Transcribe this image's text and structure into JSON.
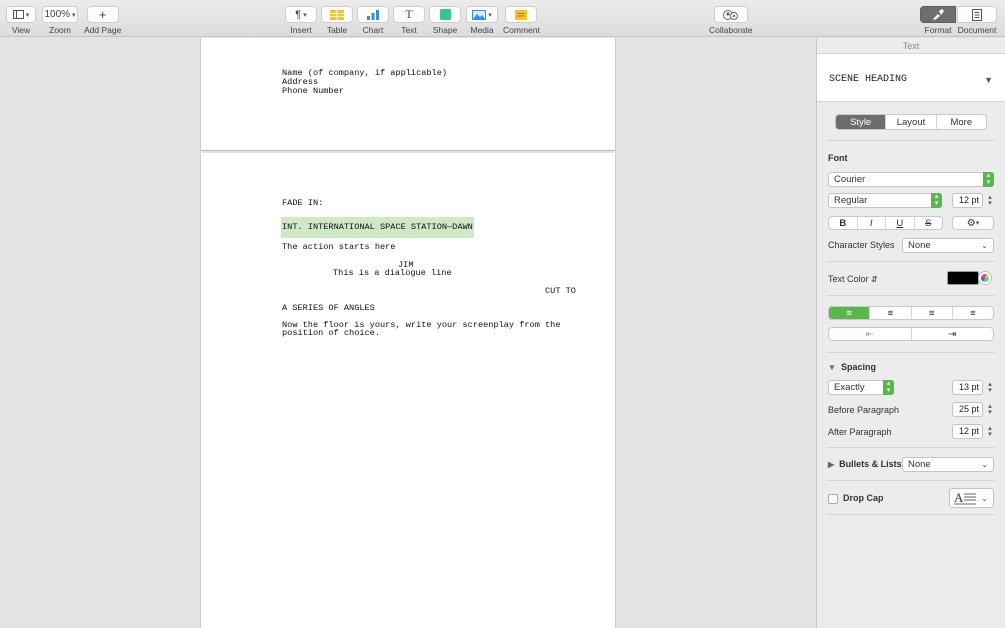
{
  "toolbar": {
    "view": {
      "label": "View"
    },
    "zoom": {
      "value": "100%",
      "label": "Zoom"
    },
    "add_page": {
      "label": "Add Page"
    },
    "insert": {
      "label": "Insert"
    },
    "table": {
      "label": "Table"
    },
    "chart": {
      "label": "Chart"
    },
    "text": {
      "label": "Text"
    },
    "shape": {
      "label": "Shape"
    },
    "media": {
      "label": "Media"
    },
    "comment": {
      "label": "Comment"
    },
    "collaborate": {
      "label": "Collaborate"
    },
    "format": {
      "label": "Format"
    },
    "document": {
      "label": "Document"
    }
  },
  "document": {
    "page1_lines": [
      "Name (of company, if applicable)",
      "Address",
      "Phone Number"
    ],
    "fade_in": "FADE IN:",
    "scene_heading": "INT. INTERNATIONAL SPACE STATION—DAWN",
    "action": "The action starts here",
    "character": "JIM",
    "dialogue": "This is a dialogue line",
    "transition": "CUT TO",
    "shot": "A SERIES OF ANGLES",
    "closing_line1": "Now the floor is yours, write your screenplay from the",
    "closing_line2": "position of choice."
  },
  "inspector": {
    "header": "Text",
    "paragraph_style": "SCENE HEADING",
    "tabs": [
      "Style",
      "Layout",
      "More"
    ],
    "font_section": "Font",
    "font_family": "Courier",
    "font_style": "Regular",
    "font_size": "12 pt",
    "format_buttons": [
      "B",
      "I",
      "U",
      "S"
    ],
    "gear": "⚙",
    "character_styles_label": "Character Styles",
    "character_styles_value": "None",
    "text_color_label": "Text Color",
    "text_color": "#000000",
    "spacing_label": "Spacing",
    "spacing_mode": "Exactly",
    "spacing_value": "13 pt",
    "before_paragraph_label": "Before Paragraph",
    "before_paragraph_value": "25 pt",
    "after_paragraph_label": "After Paragraph",
    "after_paragraph_value": "12 pt",
    "bullets_label": "Bullets & Lists",
    "bullets_value": "None",
    "drop_cap_label": "Drop Cap",
    "accent_color": "#58b84a"
  }
}
